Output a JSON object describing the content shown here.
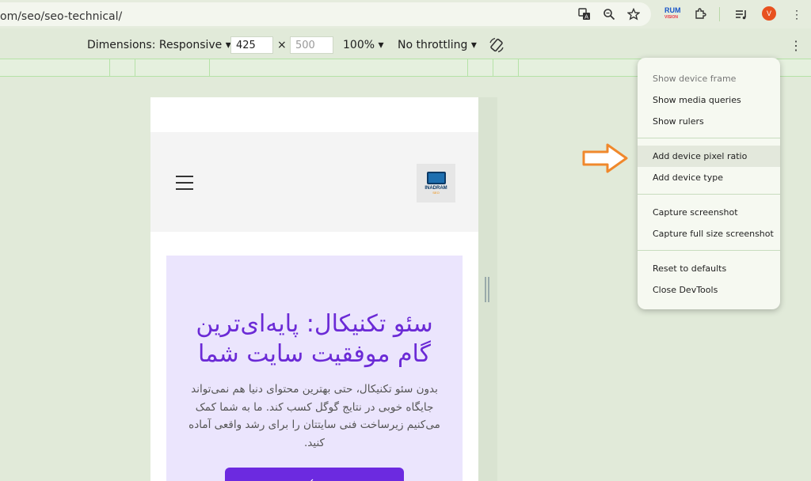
{
  "browser": {
    "url": "om/seo/seo-technical/",
    "avatar_letter": "V",
    "extension_label": "RUM",
    "extension_sub": "VISION"
  },
  "device_toolbar": {
    "dimensions_label": "Dimensions: Responsive ▾",
    "width": "425",
    "times": "×",
    "height_placeholder": "500",
    "zoom": "100% ▾",
    "throttling": "No throttling ▾"
  },
  "site": {
    "logo_text": "INADRAM",
    "logo_sub": "SEO",
    "hero_title": "سئو تکنیکال: پایه‌ای‌ترین گام موفقیت سایت شما",
    "hero_text": "بدون سئو تکنیکال، حتی بهترین محتوای دنیا هم نمی‌تواند جایگاه خوبی در نتایج گوگل کسب کند. ما به شما کمک می‌کنیم زیرساخت فنی سایتتان را برای رشد واقعی آماده کنید.",
    "hero_button": "←"
  },
  "menu": {
    "show_device_frame": "Show device frame",
    "show_media_queries": "Show media queries",
    "show_rulers": "Show rulers",
    "add_device_pixel_ratio": "Add device pixel ratio",
    "add_device_type": "Add device type",
    "capture_screenshot": "Capture screenshot",
    "capture_full_size_screenshot": "Capture full size screenshot",
    "reset_to_defaults": "Reset to defaults",
    "close_devtools": "Close DevTools"
  },
  "colors": {
    "accent_purple": "#6b2ad6",
    "arrow_orange": "#f0882c",
    "avatar": "#e8511f"
  }
}
